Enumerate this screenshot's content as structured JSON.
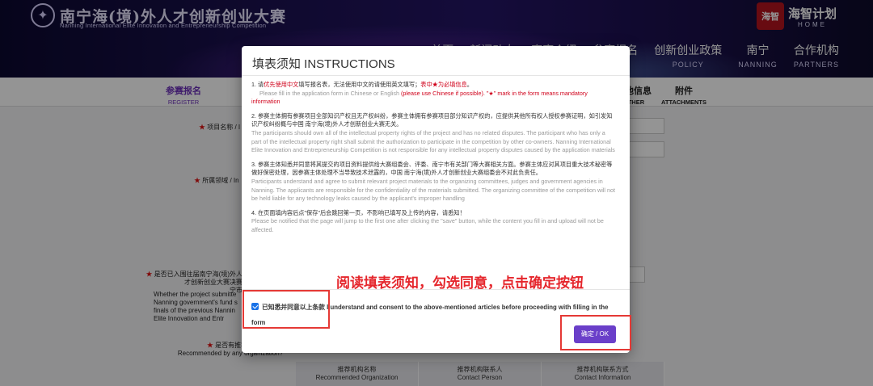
{
  "header": {
    "logo_title": "南宁海(境)外人才创新创业大赛",
    "logo_subtitle": "Nanning International Elite Innovation and Entrepreneurship Competition",
    "brand_seal": "海智",
    "brand_name": "海智计划",
    "brand_home": "HOME",
    "nav": [
      {
        "cn": "首页",
        "en": ""
      },
      {
        "cn": "新闻动态",
        "en": ""
      },
      {
        "cn": "赛事介绍",
        "en": ""
      },
      {
        "cn": "参赛报名",
        "en": "ENTRY"
      },
      {
        "cn": "创新创业政策",
        "en": "POLICY"
      },
      {
        "cn": "南宁",
        "en": "NANNING"
      },
      {
        "cn": "合作机构",
        "en": "PARTNERS"
      }
    ]
  },
  "tabs": [
    {
      "cn": "参赛报名",
      "en": "REGISTER"
    },
    {
      "cn": "其他信息",
      "en": "OTHER"
    },
    {
      "cn": "附件",
      "en": "ATTACHMENTS"
    }
  ],
  "form": {
    "project_name": "项目名称 / I",
    "field_label": "所属领域 / In",
    "settled_label": "是否已入围往届南宁海(境)外人才创新创业大赛决赛",
    "settled_sub": "宁市",
    "whether_lines": [
      "Whether the project submitte",
      "Nanning government's fund s",
      "finals of the previous Nannin",
      "Elite Innovation and Entr"
    ],
    "recommended_cn": "是否有推荐机",
    "recommended_en": "Recommended by any organization?",
    "table_headers": [
      {
        "cn": "推荐机构名称",
        "en": "Recommended Organization"
      },
      {
        "cn": "推荐机构联系人",
        "en": "Contact Person"
      },
      {
        "cn": "推荐机构联系方式",
        "en": "Contact Information"
      }
    ]
  },
  "modal": {
    "title": "填表须知 INSTRUCTIONS",
    "p1_cn_pre": "1. 请",
    "p1_cn_red1": "优先使用中文",
    "p1_cn_mid": "填写报名表，无法使用中文的请使用英文填写；",
    "p1_cn_red2": "表中★为必填信息",
    "p1_cn_post": "。",
    "p1_en_pre": "Please fill in the application form in Chinese or English ",
    "p1_en_red": "(please use Chinese if possible). \"★\" mark in the form means mandatory information",
    "p2_cn": "2. 参赛主体拥有参赛项目全部知识产权且无产权纠纷，参赛主体拥有参赛项目部分知识产权的，应提供其他所有权人授权参赛证明，如引发知识产权纠纷概与中国 南宁海(境)外人才创新创业大赛无关。",
    "p2_en": "The participants should own all of the intellectual property rights of the project and has no related disputes. The participant who has only a part of the intellectual property right shall submit the authorization to participate in the competition by other co-owners. Nanning International Elite Innovation and Entrepreneurship Competition is not responsible for any intellectual property disputes caused by the application materials",
    "p3_cn": "3. 参赛主体知悉并同意将其提交的项目资料提供给大赛组委会、评委、南宁市有关部门等大赛相关方面。参赛主体应对其项目重大技术秘密等做好保密处理，因参赛主体处理不当导致技术泄露的，中国 南宁海(境)外人才创新创业大赛组委会不对此负责任。",
    "p3_en": "Participants understand and agree to submit relevant project materials to the organizing committees, judges and government agencies in Nanning. The applicants are responsible for the confidentiality of the materials submitted. The organizing committee of the competition will not be held liable for any technology leaks caused by the applicant's improper handling",
    "p4_cn": "4. 在页面填内容后点\"保存\"后会跳回第一页，不影响已填写及上传的内容，请悉知！",
    "p4_en": "Please be notified that the page will jump to the first one after clicking the \"save\" button, while the content you fill in and upload will not be affected.",
    "agree_text": "已知悉并同意以上条款 I understand and consent to the above-mentioned articles before proceeding with filling in the form",
    "ok_label": "确定 / OK"
  },
  "annotation": {
    "text": "阅读填表须知，勾选同意，点击确定按钮",
    "color": "#e5262c"
  }
}
